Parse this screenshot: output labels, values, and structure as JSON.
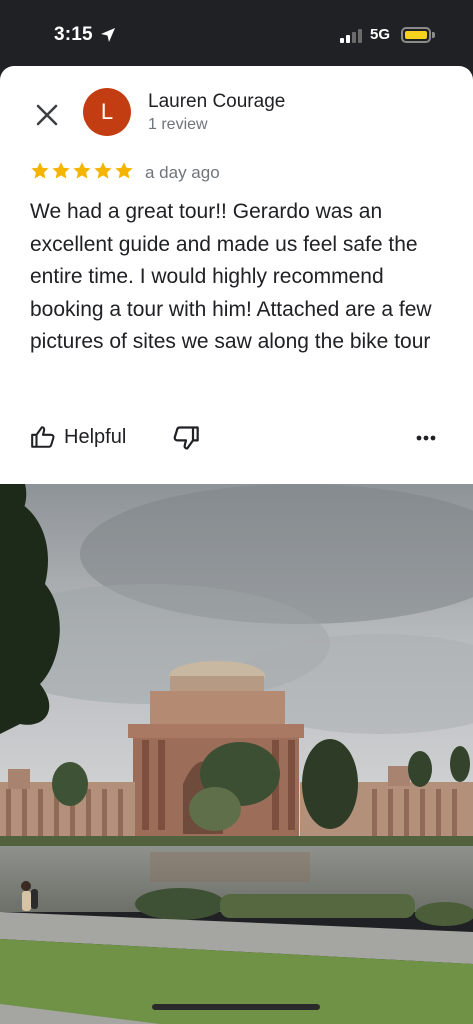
{
  "status_bar": {
    "time": "3:15",
    "network": "5G",
    "battery_color": "#f5d21e"
  },
  "review": {
    "avatar_letter": "L",
    "avatar_color": "#c33d13",
    "reviewer_name": "Lauren Courage",
    "reviewer_review_count": "1 review",
    "rating": 5,
    "star_color": "#f4b400",
    "time_ago": "a day ago",
    "text": "We had a great tour!! Gerardo was an excellent guide and made us feel safe the entire time. I would highly recommend booking a tour with him! Attached are a few pictures of sites we saw along the bike tour",
    "actions": {
      "helpful_label": "Helpful",
      "helpful_icon": "thumbs-up-icon",
      "not_helpful_icon": "thumbs-down-icon",
      "more_icon": "more-horizontal-icon"
    }
  },
  "photo": {
    "subject": "Palace of Fine Arts"
  }
}
